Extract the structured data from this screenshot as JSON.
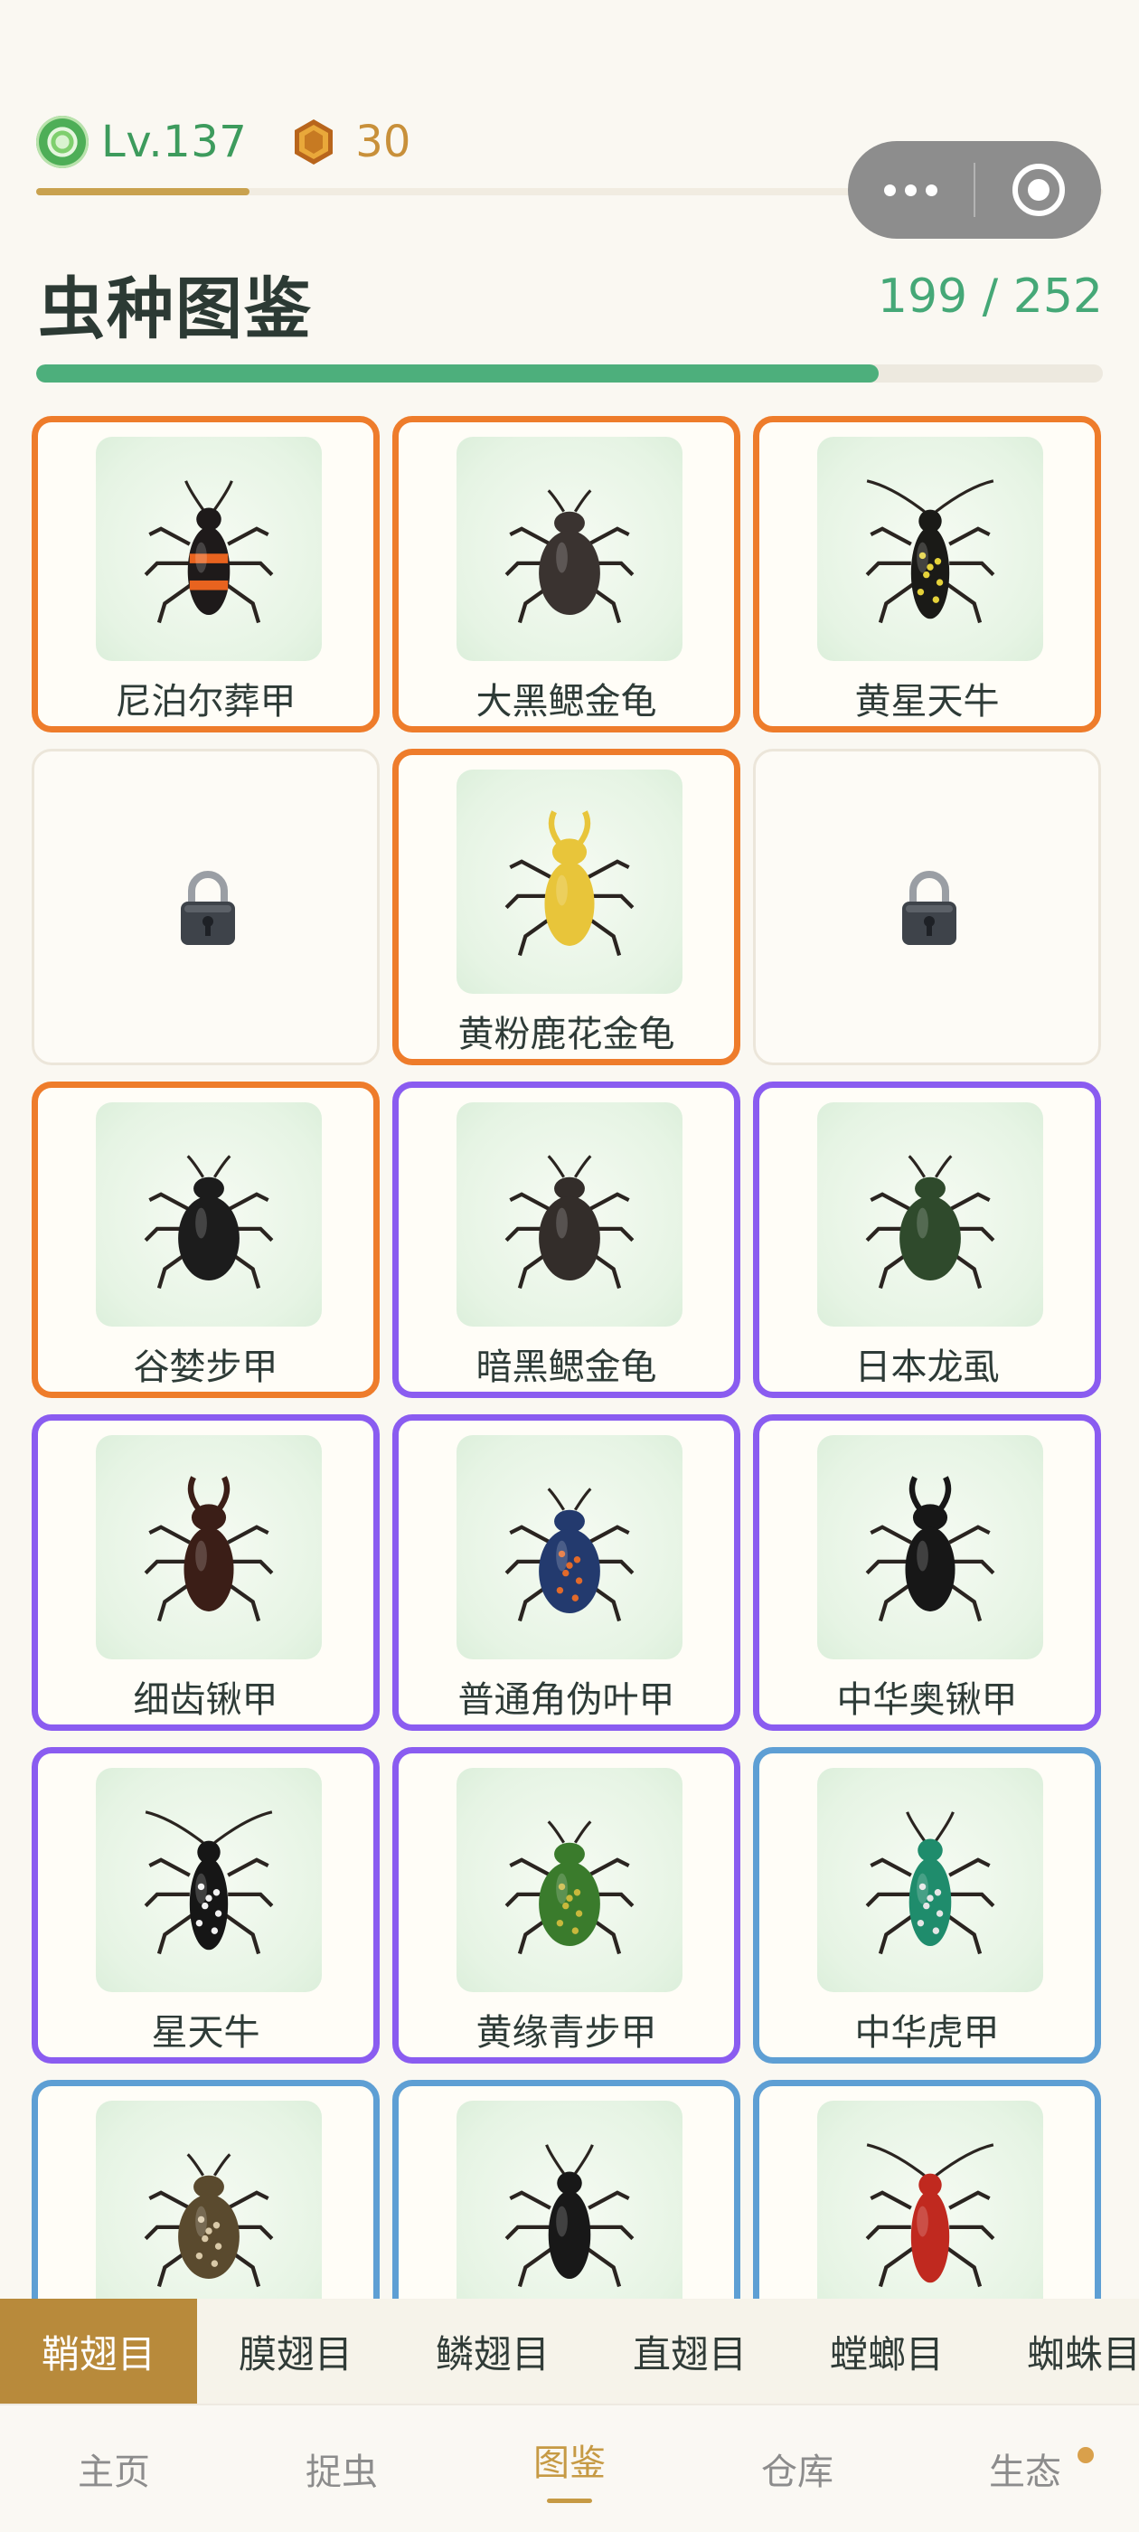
{
  "status": {
    "level": "Lv.137",
    "coins": "30",
    "xp_progress": 0.2
  },
  "header": {
    "title": "虫种图鉴",
    "collected": "199",
    "separator": " / ",
    "total": "252",
    "progress": 0.79
  },
  "colors": {
    "orange_tier": "#ee7c2b",
    "purple_tier": "#8a5cf0",
    "blue_tier": "#5e9fd4",
    "accent_green": "#4daf7c",
    "accent_gold": "#c69a44"
  },
  "cards": [
    {
      "name": "尼泊尔葬甲",
      "tier": "orange",
      "locked": false,
      "icon": "burying-beetle-icon",
      "body": "#1e1a1a",
      "stripe": "#e8631f",
      "shape": "long"
    },
    {
      "name": "大黑鳃金龟",
      "tier": "orange",
      "locked": false,
      "icon": "chafer-icon",
      "body": "#3a3330",
      "stripe": "",
      "shape": "oval"
    },
    {
      "name": "黄星天牛",
      "tier": "orange",
      "locked": false,
      "icon": "longhorn-icon",
      "body": "#1a1a17",
      "stripe": "#e5d23a",
      "shape": "longhorn"
    },
    {
      "name": "",
      "tier": "locked",
      "locked": true,
      "icon": "lock-icon"
    },
    {
      "name": "黄粉鹿花金龟",
      "tier": "orange",
      "locked": false,
      "icon": "stag-chafer-icon",
      "body": "#e8c53a",
      "stripe": "",
      "shape": "stag"
    },
    {
      "name": "",
      "tier": "locked",
      "locked": true,
      "icon": "lock-icon"
    },
    {
      "name": "谷婪步甲",
      "tier": "orange",
      "locked": false,
      "icon": "ground-beetle-icon",
      "body": "#1c1c1c",
      "stripe": "",
      "shape": "oval"
    },
    {
      "name": "暗黑鳃金龟",
      "tier": "purple",
      "locked": false,
      "icon": "chafer-icon",
      "body": "#332d2a",
      "stripe": "",
      "shape": "oval"
    },
    {
      "name": "日本龙虱",
      "tier": "purple",
      "locked": false,
      "icon": "diving-beetle-icon",
      "body": "#2f4a2c",
      "stripe": "",
      "shape": "oval"
    },
    {
      "name": "细齿锹甲",
      "tier": "purple",
      "locked": false,
      "icon": "stag-beetle-icon",
      "body": "#3b1e17",
      "stripe": "",
      "shape": "stag"
    },
    {
      "name": "普通角伪叶甲",
      "tier": "purple",
      "locked": false,
      "icon": "leaf-beetle-icon",
      "body": "#233a6e",
      "stripe": "#e26a2a",
      "shape": "oval"
    },
    {
      "name": "中华奥锹甲",
      "tier": "purple",
      "locked": false,
      "icon": "stag-beetle-icon",
      "body": "#171717",
      "stripe": "",
      "shape": "stag"
    },
    {
      "name": "星天牛",
      "tier": "purple",
      "locked": false,
      "icon": "longhorn-icon",
      "body": "#161616",
      "stripe": "#f2f2f2",
      "shape": "longhorn"
    },
    {
      "name": "黄缘青步甲",
      "tier": "purple",
      "locked": false,
      "icon": "ground-beetle-icon",
      "body": "#3a7b2c",
      "stripe": "#c8b83c",
      "shape": "oval"
    },
    {
      "name": "中华虎甲",
      "tier": "blue",
      "locked": false,
      "icon": "tiger-beetle-icon",
      "body": "#1f8c6c",
      "stripe": "#e6e6e6",
      "shape": "long"
    },
    {
      "name": "",
      "tier": "blue",
      "locked": false,
      "icon": "flower-chafer-icon",
      "body": "#5a4a2e",
      "stripe": "#d9c9a8",
      "shape": "oval"
    },
    {
      "name": "",
      "tier": "blue",
      "locked": false,
      "icon": "ground-beetle-icon",
      "body": "#181818",
      "stripe": "",
      "shape": "long"
    },
    {
      "name": "",
      "tier": "blue",
      "locked": false,
      "icon": "longhorn-icon",
      "body": "#c0291f",
      "stripe": "",
      "shape": "longhorn"
    }
  ],
  "categories": [
    {
      "label": "鞘翅目",
      "active": true
    },
    {
      "label": "膜翅目",
      "active": false
    },
    {
      "label": "鳞翅目",
      "active": false
    },
    {
      "label": "直翅目",
      "active": false
    },
    {
      "label": "螳螂目",
      "active": false
    },
    {
      "label": "蜘蛛目",
      "active": false
    }
  ],
  "nav": [
    {
      "label": "主页",
      "active": false,
      "badge": false
    },
    {
      "label": "捉虫",
      "active": false,
      "badge": false
    },
    {
      "label": "图鉴",
      "active": true,
      "badge": false
    },
    {
      "label": "仓库",
      "active": false,
      "badge": false
    },
    {
      "label": "生态",
      "active": false,
      "badge": true
    }
  ]
}
